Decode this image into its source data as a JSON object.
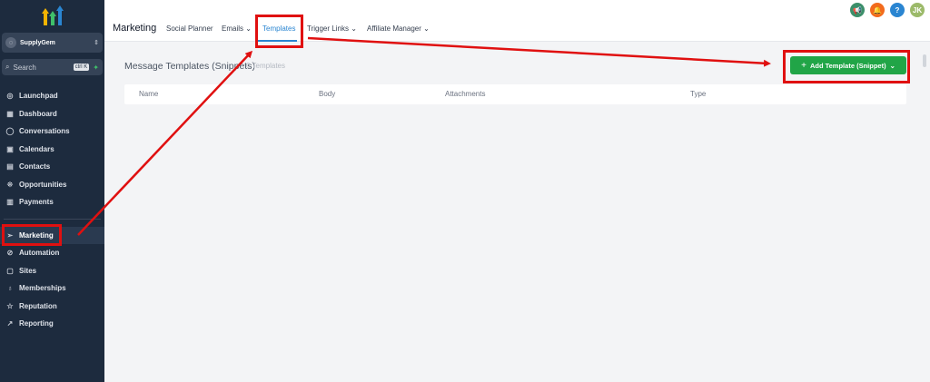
{
  "account": {
    "name": "SupplyGem"
  },
  "search": {
    "placeholder": "Search",
    "shortcut": "ctrl K"
  },
  "sidebar": {
    "items": [
      {
        "label": "Launchpad",
        "icon": "rocket-icon",
        "glyph": "◎"
      },
      {
        "label": "Dashboard",
        "icon": "dashboard-icon",
        "glyph": "▦"
      },
      {
        "label": "Conversations",
        "icon": "chat-icon",
        "glyph": "◯"
      },
      {
        "label": "Calendars",
        "icon": "calendar-icon",
        "glyph": "▣"
      },
      {
        "label": "Contacts",
        "icon": "contacts-icon",
        "glyph": "▤"
      },
      {
        "label": "Opportunities",
        "icon": "opportunities-icon",
        "glyph": "⁜"
      },
      {
        "label": "Payments",
        "icon": "payments-icon",
        "glyph": "▥"
      }
    ],
    "items2": [
      {
        "label": "Marketing",
        "icon": "send-icon",
        "glyph": "➢",
        "active": true
      },
      {
        "label": "Automation",
        "icon": "automation-icon",
        "glyph": "⊘"
      },
      {
        "label": "Sites",
        "icon": "sites-icon",
        "glyph": "▢"
      },
      {
        "label": "Memberships",
        "icon": "memberships-icon",
        "glyph": "♁"
      },
      {
        "label": "Reputation",
        "icon": "star-icon",
        "glyph": "☆"
      },
      {
        "label": "Reporting",
        "icon": "reporting-icon",
        "glyph": "↗"
      }
    ]
  },
  "header": {
    "title": "Marketing",
    "tabs": [
      {
        "label": "Social Planner"
      },
      {
        "label": "Emails"
      },
      {
        "label": "Templates",
        "active": true
      },
      {
        "label": "Trigger Links"
      },
      {
        "label": "Affiliate Manager"
      }
    ],
    "avatar_initials": "JK"
  },
  "main": {
    "title": "Message Templates (Snippets)",
    "subtitle": "0 Templates",
    "add_button": "Add Template (Snippet)",
    "columns": [
      "Name",
      "Body",
      "Attachments",
      "Type"
    ]
  },
  "colors": {
    "sidebar_bg": "#1d2b3e",
    "accent": "#2a85d1",
    "add_button": "#21a547",
    "annotation": "#e01010"
  }
}
